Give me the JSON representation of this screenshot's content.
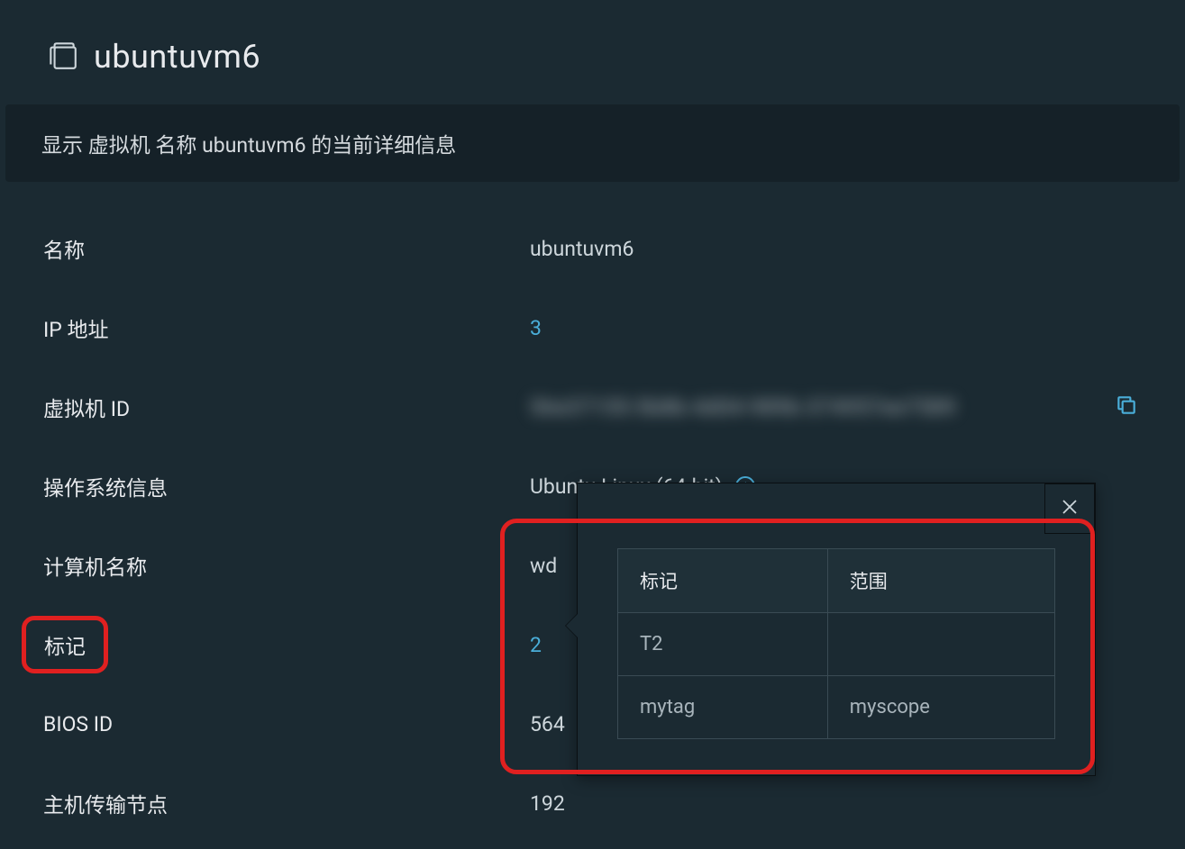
{
  "header": {
    "title": "ubuntuvm6"
  },
  "description": "显示 虚拟机 名称 ubuntuvm6 的当前详细信息",
  "details": {
    "name_label": "名称",
    "name_value": "ubuntuvm6",
    "ip_label": "IP 地址",
    "ip_value": "3",
    "vmid_label": "虚拟机 ID",
    "vmid_value": "56e37155-5b8b-4d04-989b-374957ee7589",
    "os_label": "操作系统信息",
    "os_value": "Ubuntu Linux (64-bit)",
    "hostname_label": "计算机名称",
    "hostname_value": "wd",
    "tags_label": "标记",
    "tags_value": "2",
    "biosid_label": "BIOS ID",
    "biosid_value": "564",
    "transport_label": "主机传输节点",
    "transport_value": "192"
  },
  "popover": {
    "col_tag": "标记",
    "col_scope": "范围",
    "rows": [
      {
        "tag": "T2",
        "scope": ""
      },
      {
        "tag": "mytag",
        "scope": "myscope"
      }
    ]
  },
  "colors": {
    "bg": "#1b2a32",
    "link": "#4aaed9",
    "highlight": "#e02020"
  }
}
